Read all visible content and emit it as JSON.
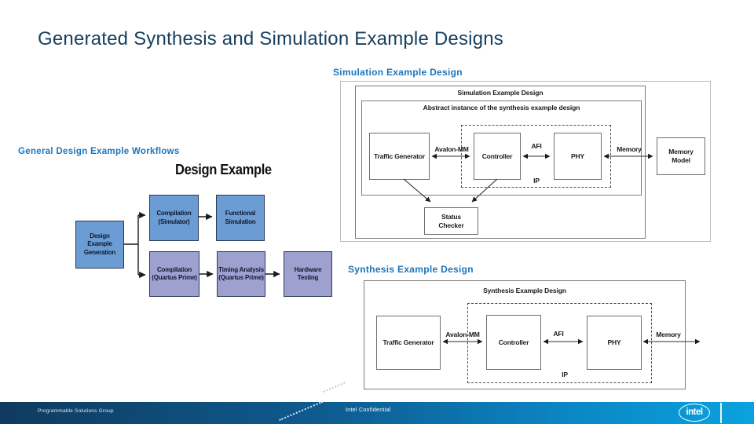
{
  "slide": {
    "title": "Generated Synthesis and Simulation Example Designs"
  },
  "workflows": {
    "heading": "General Design Example Workflows",
    "diagram_title": "Design Example",
    "nodes": {
      "generation": "Design\nExample\nGeneration",
      "compilation_simulator": "Compilation\n(Simulator)",
      "functional_simulation": "Functional\nSimulation",
      "compilation_quartus": "Compilation\n(Quartus Prime)",
      "timing_analysis": "Timing Analysis\n(Quartus Prime)",
      "hardware_testing": "Hardware\nTesting"
    }
  },
  "simulation": {
    "heading": "Simulation Example Design",
    "outer_title": "Simulation Example Design",
    "inner_title": "Abstract instance of the synthesis example design",
    "blocks": {
      "traffic_generator": "Traffic Generator",
      "controller": "Controller",
      "phy": "PHY",
      "memory_model": "Memory\nModel",
      "status_checker": "Status\nChecker"
    },
    "bus_labels": {
      "avalon": "Avalon-MM",
      "afi": "AFI",
      "memory": "Memory",
      "ip": "IP"
    }
  },
  "synthesis": {
    "heading": "Synthesis Example Design",
    "outer_title": "Synthesis Example Design",
    "blocks": {
      "traffic_generator": "Traffic Generator",
      "controller": "Controller",
      "phy": "PHY"
    },
    "bus_labels": {
      "avalon": "Avalon-MM",
      "afi": "AFI",
      "memory": "Memory",
      "ip": "IP"
    }
  },
  "footer": {
    "group": "Programmable Solutions Group",
    "confidential": "Intel Confidential",
    "logo": "intel"
  },
  "colors": {
    "title_text": "#17405F",
    "section_heading": "#1B75BB",
    "workflow_box_blue": "#6B9CD3",
    "workflow_box_lavender": "#9EA1D0",
    "footer_dark": "#0F3A5E",
    "footer_light": "#0AA2DE"
  }
}
